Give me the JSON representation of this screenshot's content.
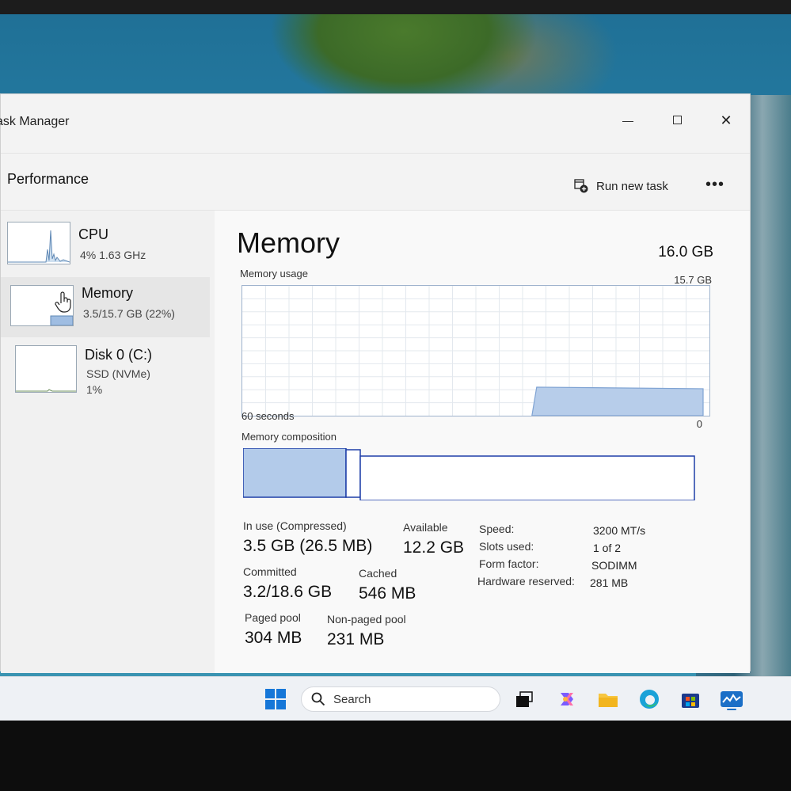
{
  "window": {
    "title": "ask Manager"
  },
  "cmdbar": {
    "section_title": "Performance",
    "run_task_label": "Run new task",
    "more_label": "•••"
  },
  "sidebar": {
    "items": [
      {
        "name": "CPU",
        "sub1": "4% 1.63 GHz"
      },
      {
        "name": "Memory",
        "sub1": "3.5/15.7 GB (22%)"
      },
      {
        "name": "Disk 0 (C:)",
        "sub1": "SSD (NVMe)",
        "sub2": "1%"
      }
    ]
  },
  "main": {
    "title": "Memory",
    "total": "16.0 GB",
    "usage_label": "Memory usage",
    "usage_max": "15.7 GB",
    "time_label": "60 seconds",
    "zero_label": "0",
    "composition_label": "Memory composition",
    "usage_fraction": 0.22,
    "stats": {
      "in_use_label": "In use (Compressed)",
      "in_use_value": "3.5 GB (26.5 MB)",
      "available_label": "Available",
      "available_value": "12.2 GB",
      "committed_label": "Committed",
      "committed_value": "3.2/18.6 GB",
      "cached_label": "Cached",
      "cached_value": "546 MB",
      "paged_label": "Paged pool",
      "paged_value": "304 MB",
      "nonpaged_label": "Non-paged pool",
      "nonpaged_value": "231 MB"
    },
    "specs": [
      {
        "key": "Speed:",
        "value": "3200 MT/s"
      },
      {
        "key": "Slots used:",
        "value": "1 of 2"
      },
      {
        "key": "Form factor:",
        "value": "SODIMM"
      },
      {
        "key": "Hardware reserved:",
        "value": "281 MB"
      }
    ]
  },
  "taskbar": {
    "search_placeholder": "Search"
  },
  "colors": {
    "accent": "#1f3fa8",
    "fill": "#b7cdea",
    "graph_grid": "#e3e8ee"
  }
}
